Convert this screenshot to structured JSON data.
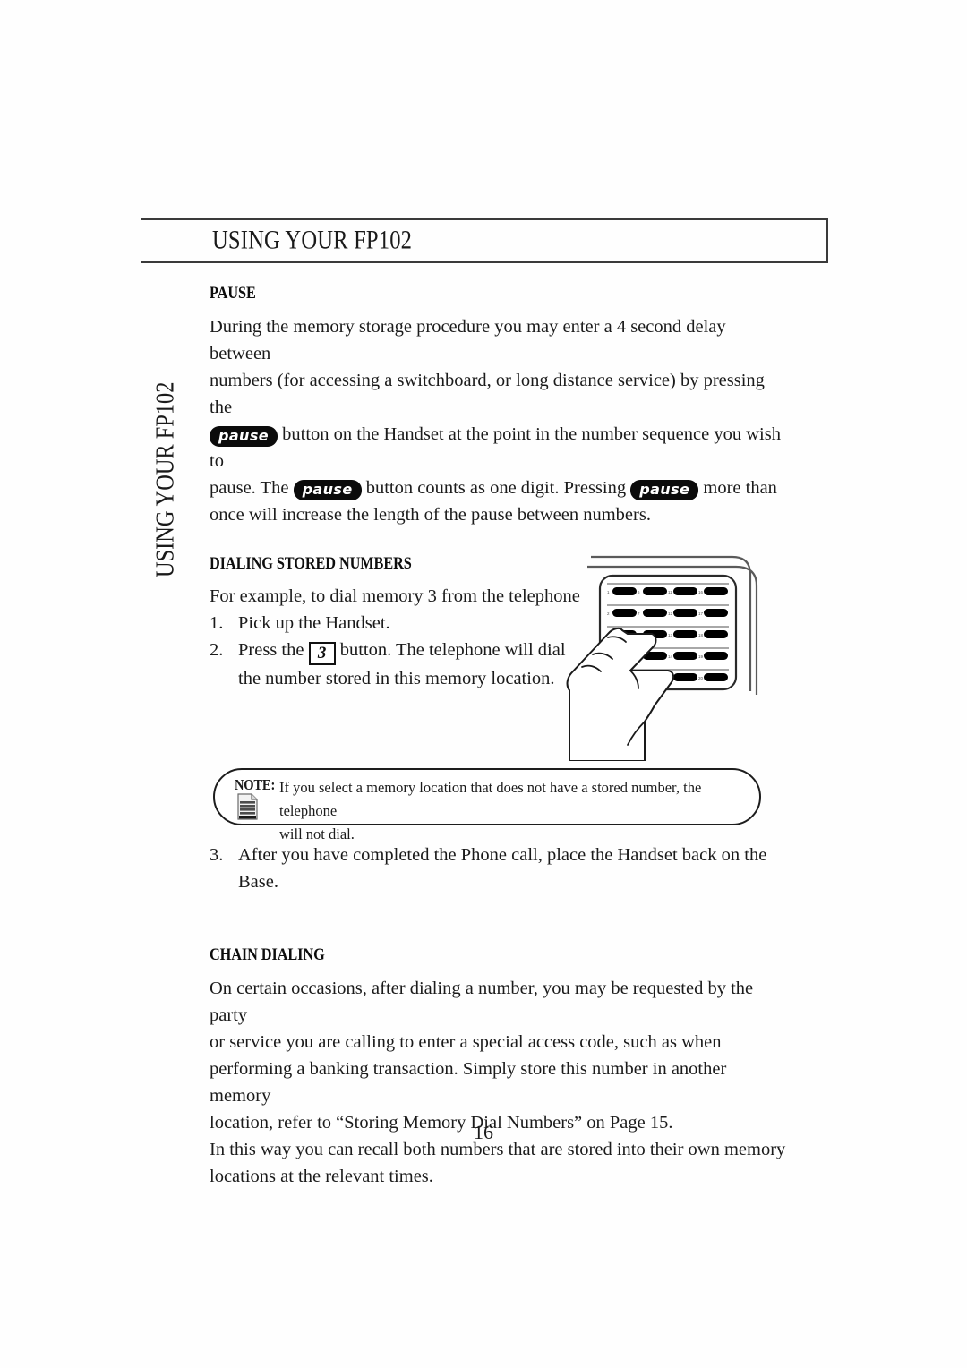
{
  "document": {
    "header_title": "USING YOUR FP102",
    "side_tab_text": "USING YOUR FP102",
    "page_number": "16"
  },
  "pause_section": {
    "heading": "PAUSE",
    "line1": "During the memory storage procedure you may enter a 4 second delay between",
    "line2": "numbers (for accessing a switchboard, or long distance service) by pressing the",
    "line3_after_pill": "button on the Handset at the point in the number sequence you wish to",
    "line4_a": "pause.  The",
    "line4_b": "button counts as one digit.  Pressing",
    "line4_c": "more than",
    "line5": "once will increase the length of the pause between numbers.",
    "pause_button_label": "pause"
  },
  "dialing_section": {
    "heading": "DIALING STORED NUMBERS",
    "intro": "For example, to dial memory 3 from the telephone",
    "step1_num": "1.",
    "step1_text": "Pick up the Handset.",
    "step2_num": "2.",
    "step2_a": "Press the",
    "step2_key_label": "3",
    "step2_b": "button. The telephone will dial",
    "step2_cont": "the number stored in this memory location.",
    "step3_num": "3.",
    "step3_text": "After you have completed the Phone call, place the Handset back on the Base."
  },
  "note": {
    "label": "NOTE:",
    "line1": "If you select a memory location that does not have a stored number, the telephone",
    "line2": "will not dial.",
    "icon": "document-icon"
  },
  "chain_section": {
    "heading": "CHAIN DIALING",
    "line1": "On certain occasions, after dialing a number, you may be requested by the party",
    "line2": "or service you are calling to enter a special access code, such as when",
    "line3": "performing a banking transaction. Simply store this number in another memory",
    "line4": "location, refer to “Storing Memory Dial Numbers” on Page 15.",
    "line5": "In this way you can recall both numbers that are stored into their own memory",
    "line6": "locations at the relevant times."
  },
  "illustration": {
    "name": "hand-pressing-memory-keypad",
    "keypad_columns": 4,
    "keypad_rows": 5,
    "key_fill": "#000000",
    "outline_color": "#1a1a1a"
  }
}
